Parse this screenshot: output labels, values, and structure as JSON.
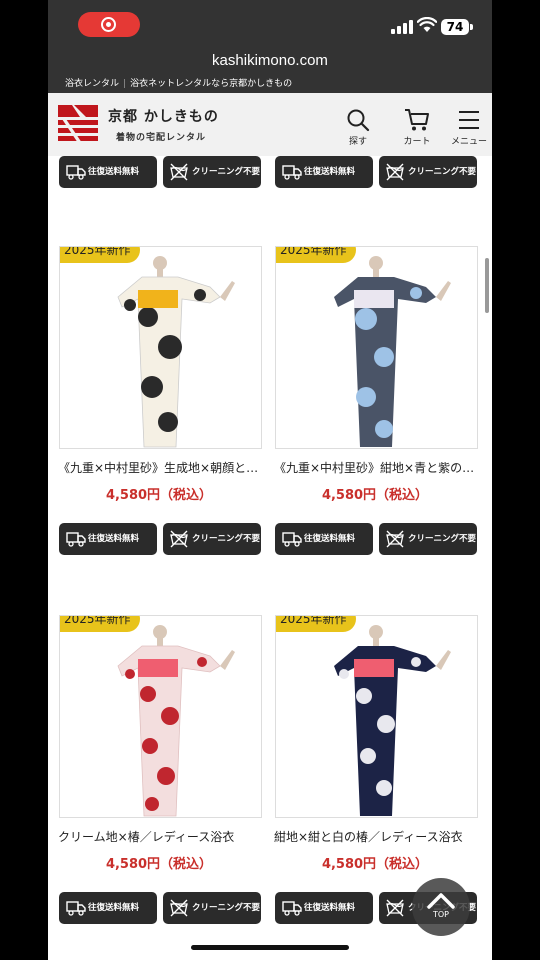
{
  "status_bar": {
    "battery": "74"
  },
  "browser": {
    "url": "kashikimono.com"
  },
  "site": {
    "breadcrumb": [
      "浴衣レンタル",
      "浴衣ネットレンタルなら京都かしきもの"
    ],
    "brand_name": "京都 かしきもの",
    "brand_sub": "着物の宅配レンタル",
    "nav": {
      "search": "探す",
      "cart": "カート",
      "menu": "メニュー"
    }
  },
  "tags": {
    "shipping": "往復送料無料",
    "cleaning": "クリーニング不要"
  },
  "products": [
    {
      "badge": "2025年新作",
      "name": "《九重×中村里砂》生成地×朝顔と…",
      "price": "4,580円（税込）",
      "colors": {
        "bg": "#f5f0e4",
        "pattern": "#2a2a2a",
        "obi": "#f1b31b"
      }
    },
    {
      "badge": "2025年新作",
      "name": "《九重×中村里砂》紺地×青と紫の…",
      "price": "4,580円（税込）",
      "colors": {
        "bg": "#4a5467",
        "pattern": "#9ec2e6",
        "obi": "#eae6f0"
      }
    },
    {
      "badge": "2025年新作",
      "name": "クリーム地×椿／レディース浴衣",
      "price": "4,580円（税込）",
      "colors": {
        "bg": "#f3dede",
        "pattern": "#c0262f",
        "obi": "#ef5e70"
      }
    },
    {
      "badge": "2025年新作",
      "name": "紺地×紺と白の椿／レディース浴衣",
      "price": "4,580円（税込）",
      "colors": {
        "bg": "#1c2346",
        "pattern": "#e8e8ee",
        "obi": "#ef5e70"
      }
    }
  ],
  "top_button": "TOP",
  "colors": {
    "accent_price": "#c9302c",
    "badge": "#e8c31b",
    "header_dark": "#333333"
  }
}
